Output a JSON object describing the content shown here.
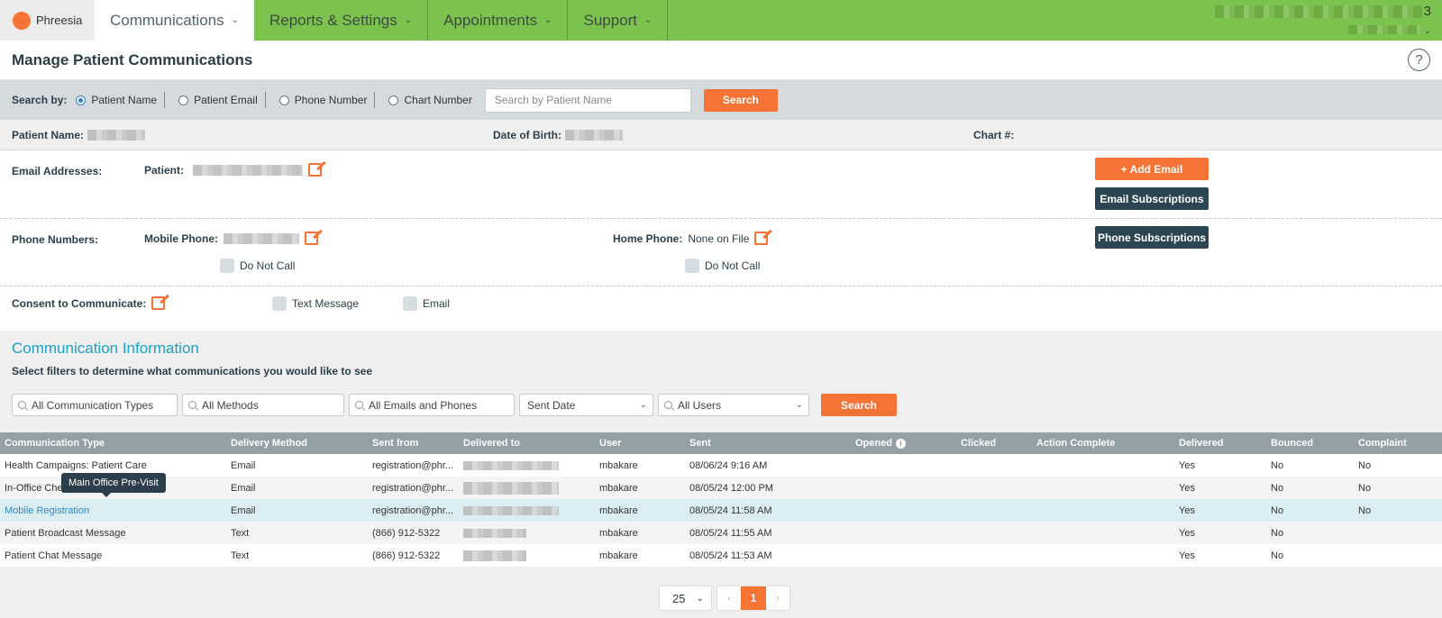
{
  "nav": {
    "brand": "Phreesia",
    "items": [
      {
        "label": "Communications",
        "active": true
      },
      {
        "label": "Reports & Settings",
        "active": false
      },
      {
        "label": "Appointments",
        "active": false
      },
      {
        "label": "Support",
        "active": false
      }
    ],
    "user_suffix": "3"
  },
  "header": {
    "title": "Manage Patient Communications",
    "help_icon": "question-circle-icon"
  },
  "search": {
    "label": "Search by:",
    "options": [
      {
        "label": "Patient Name",
        "selected": true
      },
      {
        "label": "Patient Email",
        "selected": false
      },
      {
        "label": "Phone Number",
        "selected": false
      },
      {
        "label": "Chart Number",
        "selected": false
      }
    ],
    "placeholder": "Search by Patient Name",
    "button": "Search"
  },
  "patient": {
    "name_label": "Patient Name:",
    "dob_label": "Date of Birth:",
    "chart_label": "Chart #:"
  },
  "details": {
    "email_label": "Email Addresses:",
    "email_patient_label": "Patient:",
    "add_email": "+ Add Email",
    "email_subscriptions": "Email Subscriptions",
    "phone_label": "Phone Numbers:",
    "mobile_label": "Mobile Phone:",
    "home_label": "Home Phone:",
    "home_value": "None on File",
    "do_not_call": "Do Not Call",
    "phone_subscriptions": "Phone Subscriptions",
    "consent_label": "Consent to Communicate:",
    "consent_text": "Text Message",
    "consent_email": "Email"
  },
  "comm": {
    "title": "Communication Information",
    "desc": "Select filters to determine what communications you would like to see",
    "filters": {
      "types": "All Communication Types",
      "methods": "All Methods",
      "contacts": "All Emails and Phones",
      "date": "Sent Date",
      "users": "All Users"
    },
    "search_button": "Search"
  },
  "table": {
    "headers": [
      "Communication Type",
      "Delivery Method",
      "Sent from",
      "Delivered to",
      "User",
      "Sent",
      "Opened",
      "Clicked",
      "Action Complete",
      "Delivered",
      "Bounced",
      "Complaint"
    ],
    "rows": [
      {
        "type": "Health Campaigns: Patient Care",
        "method": "Email",
        "from": "registration@phr...",
        "user": "mbakare",
        "sent": "08/06/24 9:16 AM",
        "delivered": "Yes",
        "bounced": "No",
        "complaint": "No"
      },
      {
        "type": "In-Office Check-In",
        "method": "Email",
        "from": "registration@phr...",
        "user": "mbakare",
        "sent": "08/05/24 12:00 PM",
        "delivered": "Yes",
        "bounced": "No",
        "complaint": "No"
      },
      {
        "type": "Mobile Registration",
        "method": "Email",
        "from": "registration@phr...",
        "user": "mbakare",
        "sent": "08/05/24 11:58 AM",
        "delivered": "Yes",
        "bounced": "No",
        "complaint": "No"
      },
      {
        "type": "Patient Broadcast Message",
        "method": "Text",
        "from": "(866) 912-5322",
        "user": "mbakare",
        "sent": "08/05/24 11:55 AM",
        "delivered": "Yes",
        "bounced": "No",
        "complaint": ""
      },
      {
        "type": "Patient Chat Message",
        "method": "Text",
        "from": "(866) 912-5322",
        "user": "mbakare",
        "sent": "08/05/24 11:53 AM",
        "delivered": "Yes",
        "bounced": "No",
        "complaint": ""
      }
    ],
    "tooltip": "Main Office Pre-Visit"
  },
  "pager": {
    "page_size": "25",
    "prev": "‹",
    "current": "1",
    "next": "›"
  },
  "colors": {
    "nav_green": "#7cc24e",
    "accent_orange": "#f47335",
    "dark_button": "#2c4552",
    "section_title": "#1ba3c6"
  }
}
